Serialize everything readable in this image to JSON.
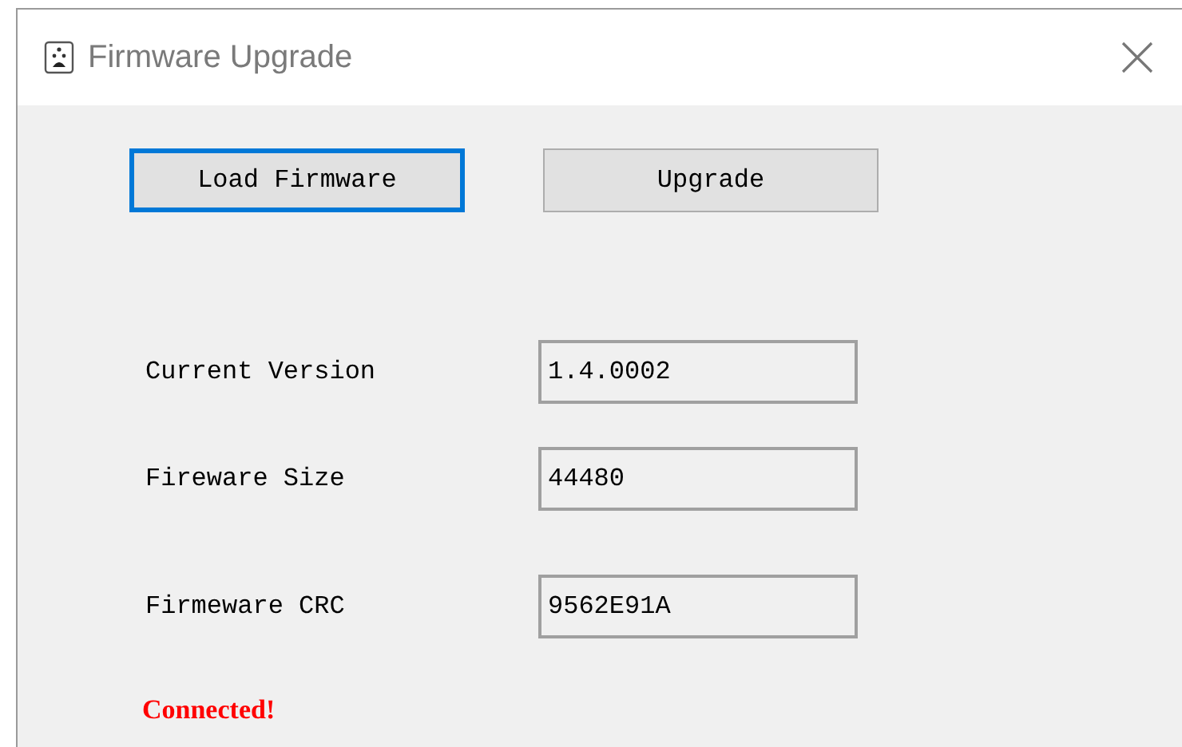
{
  "window": {
    "title": "Firmware Upgrade"
  },
  "buttons": [
    {
      "label": "Load Firmware",
      "focused": true
    },
    {
      "label": "Upgrade",
      "focused": false
    }
  ],
  "fields": [
    {
      "label": "Current Version",
      "value": "1.4.0002"
    },
    {
      "label": "Fireware Size",
      "value": "44480"
    },
    {
      "label": "Firmeware CRC",
      "value": "9562E91A"
    }
  ],
  "status": {
    "text": "Connected!"
  }
}
